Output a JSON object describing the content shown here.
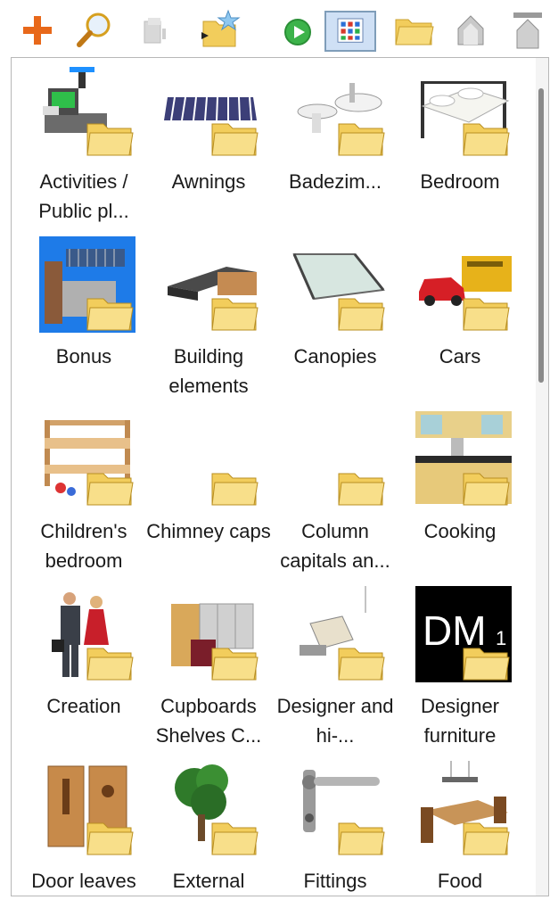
{
  "toolbar": {
    "buttons": [
      {
        "name": "add-icon"
      },
      {
        "name": "search-icon"
      },
      {
        "name": "import-icon"
      },
      {
        "name": "import-wizard-icon"
      },
      {
        "name": "play-icon"
      },
      {
        "name": "grid-view-icon"
      },
      {
        "name": "folder-icon"
      },
      {
        "name": "up-icon"
      },
      {
        "name": "back-icon"
      }
    ]
  },
  "catalog": {
    "items": [
      {
        "label": "Activities / Public pl...",
        "icon": "cash-register-icon"
      },
      {
        "label": "Awnings",
        "icon": "awning-icon"
      },
      {
        "label": "Badezim...",
        "icon": "bathroom-icon"
      },
      {
        "label": "Bedroom",
        "icon": "bed-icon"
      },
      {
        "label": "Bonus",
        "icon": "bonus-scene-icon"
      },
      {
        "label": "Building elements",
        "icon": "beam-icon"
      },
      {
        "label": "Canopies",
        "icon": "canopy-icon"
      },
      {
        "label": "Cars",
        "icon": "cars-icon"
      },
      {
        "label": "Children's bedroom",
        "icon": "bunk-bed-icon"
      },
      {
        "label": "Chimney caps",
        "icon": "folder-only-icon"
      },
      {
        "label": "Column capitals an...",
        "icon": "folder-only-icon"
      },
      {
        "label": "Cooking",
        "icon": "kitchen-icon"
      },
      {
        "label": "Creation",
        "icon": "people-icon"
      },
      {
        "label": "Cupboards Shelves C...",
        "icon": "cupboard-icon"
      },
      {
        "label": "Designer and hi-...",
        "icon": "designer-room-icon"
      },
      {
        "label": "Designer furniture",
        "icon": "dm-logo-icon"
      },
      {
        "label": "Door leaves",
        "icon": "door-icon"
      },
      {
        "label": "External",
        "icon": "tree-icon"
      },
      {
        "label": "Fittings",
        "icon": "door-handle-icon"
      },
      {
        "label": "Food",
        "icon": "dining-table-icon"
      }
    ],
    "dm_logo_text": "DM",
    "dm_logo_sub": "1"
  }
}
